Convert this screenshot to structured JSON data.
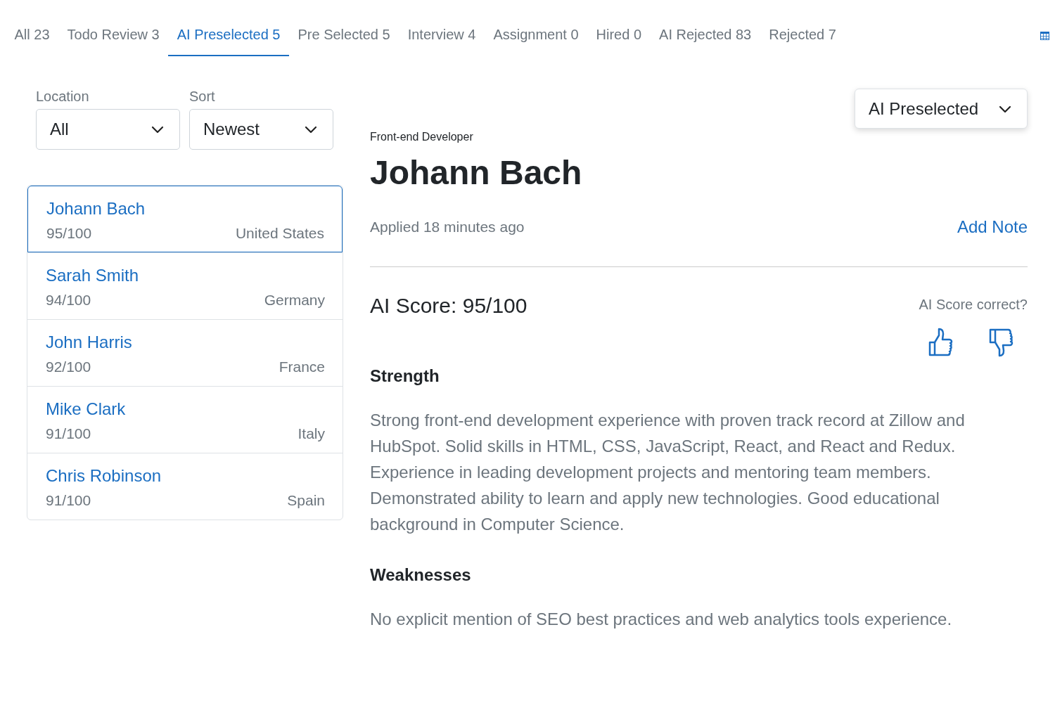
{
  "tabs": [
    {
      "label": "All 23",
      "selected": false
    },
    {
      "label": "Todo Review 3",
      "selected": false
    },
    {
      "label": "AI Preselected 5",
      "selected": true
    },
    {
      "label": "Pre Selected 5",
      "selected": false
    },
    {
      "label": "Interview 4",
      "selected": false
    },
    {
      "label": "Assignment 0",
      "selected": false
    },
    {
      "label": "Hired 0",
      "selected": false
    },
    {
      "label": "AI Rejected 83",
      "selected": false
    },
    {
      "label": "Rejected 7",
      "selected": false
    }
  ],
  "filters": [
    {
      "label": "Location",
      "value": "All"
    },
    {
      "label": "Sort",
      "value": "Newest"
    }
  ],
  "candidates": [
    {
      "name": "Johann Bach",
      "score": "95/100",
      "country": "United States",
      "selected": true
    },
    {
      "name": "Sarah Smith",
      "score": "94/100",
      "country": "Germany",
      "selected": false
    },
    {
      "name": "John Harris",
      "score": "92/100",
      "country": "France",
      "selected": false
    },
    {
      "name": "Mike Clark",
      "score": "91/100",
      "country": "Italy",
      "selected": false
    },
    {
      "name": "Chris Robinson",
      "score": "91/100",
      "country": "Spain",
      "selected": false
    }
  ],
  "detail": {
    "status": "AI Preselected",
    "job_title": "Front-end Developer",
    "name": "Johann Bach",
    "applied": "Applied 18 minutes ago",
    "add_note": "Add Note",
    "score_title": "AI Score: 95/100",
    "feedback_question": "AI Score correct?",
    "sections": [
      {
        "heading": "Strength",
        "text": "Strong front-end development experience with proven track record at Zillow and HubSpot. Solid skills in HTML, CSS, JavaScript, React, and React and Redux. Experience in leading development projects and mentoring team members. Demonstrated ability to learn and apply new technologies. Good educational background in Computer Science."
      },
      {
        "heading": "Weaknesses",
        "text": "No explicit mention of SEO best practices and web analytics tools experience."
      }
    ]
  }
}
